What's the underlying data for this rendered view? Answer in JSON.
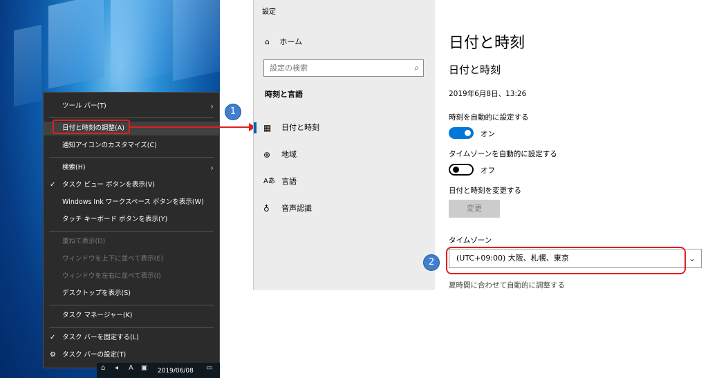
{
  "context_menu": {
    "items": [
      {
        "label": "ツール バー(T)",
        "check": "",
        "submenu": true,
        "disabled": false
      },
      {
        "label": "日付と時刻の調整(A)",
        "check": "",
        "submenu": false,
        "disabled": false
      },
      {
        "label": "通知アイコンのカスタマイズ(C)",
        "check": "",
        "submenu": false,
        "disabled": false
      },
      {
        "label": "検索(H)",
        "check": "",
        "submenu": true,
        "disabled": false
      },
      {
        "label": "タスク ビュー ボタンを表示(V)",
        "check": "✓",
        "submenu": false,
        "disabled": false
      },
      {
        "label": "Windows Ink ワークスペース ボタンを表示(W)",
        "check": "",
        "submenu": false,
        "disabled": false
      },
      {
        "label": "タッチ キーボード ボタンを表示(Y)",
        "check": "",
        "submenu": false,
        "disabled": false
      },
      {
        "label": "重ねて表示(D)",
        "check": "",
        "submenu": false,
        "disabled": true
      },
      {
        "label": "ウィンドウを上下に並べて表示(E)",
        "check": "",
        "submenu": false,
        "disabled": true
      },
      {
        "label": "ウィンドウを左右に並べて表示(I)",
        "check": "",
        "submenu": false,
        "disabled": true
      },
      {
        "label": "デスクトップを表示(S)",
        "check": "",
        "submenu": false,
        "disabled": false
      },
      {
        "label": "タスク マネージャー(K)",
        "check": "",
        "submenu": false,
        "disabled": false
      },
      {
        "label": "タスク バーを固定する(L)",
        "check": "✓",
        "submenu": false,
        "disabled": false
      },
      {
        "label": "タスク バーの設定(T)",
        "check": "⚙",
        "submenu": false,
        "disabled": false
      }
    ],
    "arrow": "›"
  },
  "taskbar": {
    "date": "2019/06/08"
  },
  "callouts": {
    "step1": "1",
    "step2": "2",
    "highlight_color": "#e02020",
    "badge_color": "#3f7fcf"
  },
  "settings": {
    "window_title": "設定",
    "home_label": "ホーム",
    "search_placeholder": "設定の検索",
    "section_title": "時刻と言語",
    "nav": [
      {
        "label": "日付と時刻",
        "icon": "calendar-icon",
        "glyph": "📅"
      },
      {
        "label": "地域",
        "icon": "globe-icon",
        "glyph": "🌐"
      },
      {
        "label": "言語",
        "icon": "language-icon",
        "glyph": "Aあ"
      },
      {
        "label": "音声認識",
        "icon": "microphone-icon",
        "glyph": "🎙"
      }
    ],
    "page_title": "日付と時刻",
    "section_heading": "日付と時刻",
    "current_time": "2019年6月8日、13:26",
    "auto_time_label": "時刻を自動的に設定する",
    "auto_time_state": "オン",
    "auto_tz_label": "タイムゾーンを自動的に設定する",
    "auto_tz_state": "オフ",
    "change_label": "日付と時刻を変更する",
    "change_button": "変更",
    "tz_label": "タイムゾーン",
    "tz_value": "(UTC+09:00) 大阪、札幌、東京",
    "dst_label": "夏時間に合わせて自動的に調整する",
    "accent": "#0078d7"
  }
}
